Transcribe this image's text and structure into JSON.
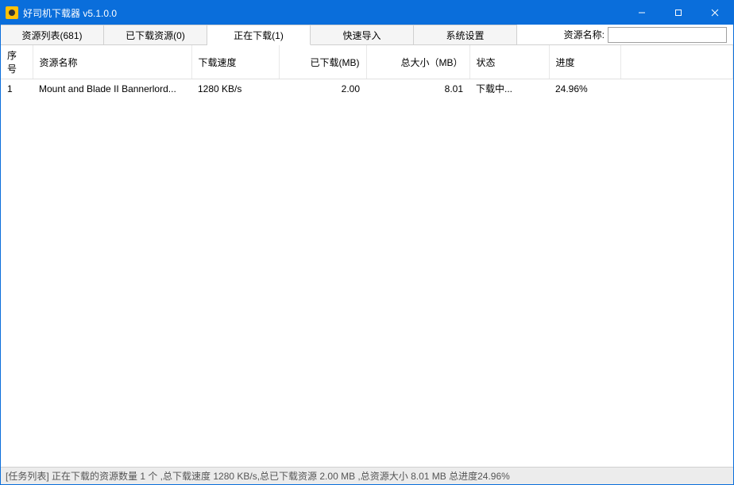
{
  "window": {
    "title": "好司机下载器 v5.1.0.0"
  },
  "tabs": {
    "resource_list": "资源列表(681)",
    "downloaded": "已下载资源(0)",
    "downloading": "正在下载(1)",
    "quick_import": "快速导入",
    "settings": "系统设置"
  },
  "search": {
    "label": "资源名称:"
  },
  "table": {
    "headers": {
      "idx": "序号",
      "name": "资源名称",
      "speed": "下载速度",
      "downloaded": "已下载(MB)",
      "total": "总大小（MB）",
      "status": "状态",
      "progress": "进度"
    },
    "rows": [
      {
        "idx": "1",
        "name": "Mount and Blade II Bannerlord...",
        "speed": "1280 KB/s",
        "downloaded": "2.00",
        "total": "8.01",
        "status": "下载中...",
        "progress": "24.96%"
      }
    ]
  },
  "statusbar": "[任务列表] 正在下载的资源数量 1 个 ,总下载速度 1280 KB/s,总已下载资源 2.00 MB ,总资源大小 8.01 MB 总进度24.96%"
}
